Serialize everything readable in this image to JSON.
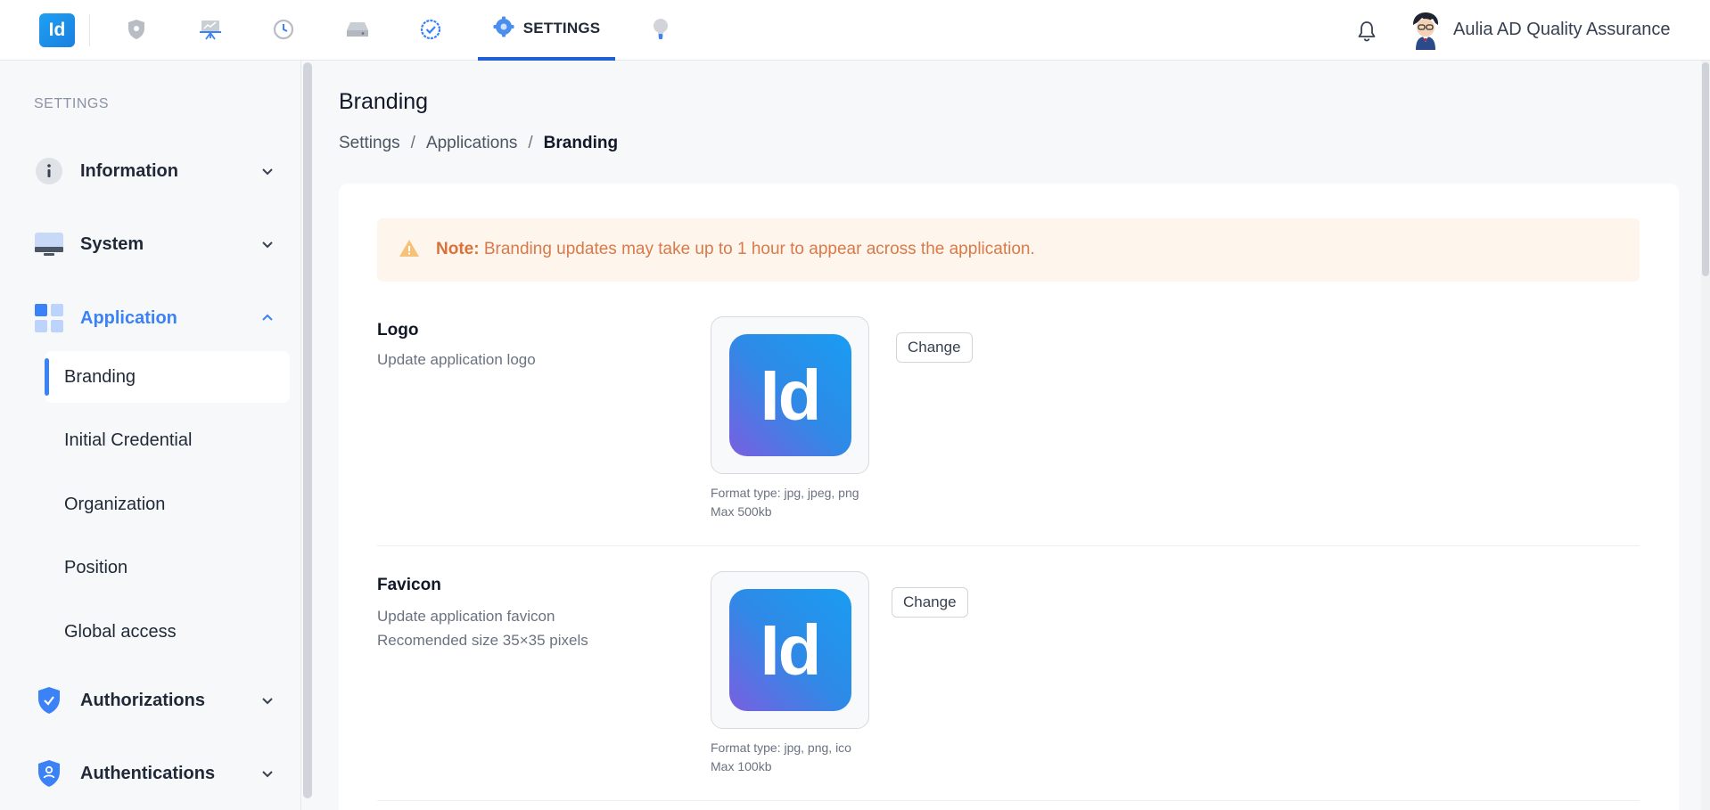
{
  "app": {
    "logo_text": "Id",
    "brand_color": "#1b7fe0",
    "accent_color": "#3b82f6"
  },
  "topnav": {
    "icons": [
      "shield-icon",
      "presentation-icon",
      "history-icon",
      "drive-icon",
      "verified-badge-icon",
      "settings-gear-icon",
      "lightbulb-icon"
    ],
    "active_label": "SETTINGS",
    "user_name": "Aulia AD Quality Assurance"
  },
  "sidebar": {
    "heading": "SETTINGS",
    "items": [
      {
        "label": "Information",
        "icon": "info-icon",
        "expanded": false
      },
      {
        "label": "System",
        "icon": "monitor-icon",
        "expanded": false
      },
      {
        "label": "Application",
        "icon": "grid-icon",
        "expanded": true
      },
      {
        "label": "Authorizations",
        "icon": "shield-check-icon",
        "expanded": false
      },
      {
        "label": "Authentications",
        "icon": "shield-user-icon",
        "expanded": false
      }
    ],
    "application_subitems": [
      "Branding",
      "Initial Credential",
      "Organization",
      "Position",
      "Global access"
    ],
    "active_subitem": "Branding"
  },
  "main": {
    "title": "Branding",
    "breadcrumb": [
      "Settings",
      "Applications",
      "Branding"
    ],
    "breadcrumb_separator": "/",
    "note": {
      "label": "Note:",
      "text": "Branding updates may take up to 1 hour to appear across the application."
    },
    "logo_section": {
      "title": "Logo",
      "description": "Update application logo",
      "image_text": "Id",
      "button": "Change",
      "format": "Format type: jpg, jpeg, png",
      "max": "Max 500kb"
    },
    "favicon_section": {
      "title": "Favicon",
      "description": "Update application favicon",
      "recommendation": "Recomended size 35×35 pixels",
      "image_text": "Id",
      "button": "Change",
      "format": "Format type: jpg, png, ico",
      "max": "Max 100kb"
    }
  }
}
